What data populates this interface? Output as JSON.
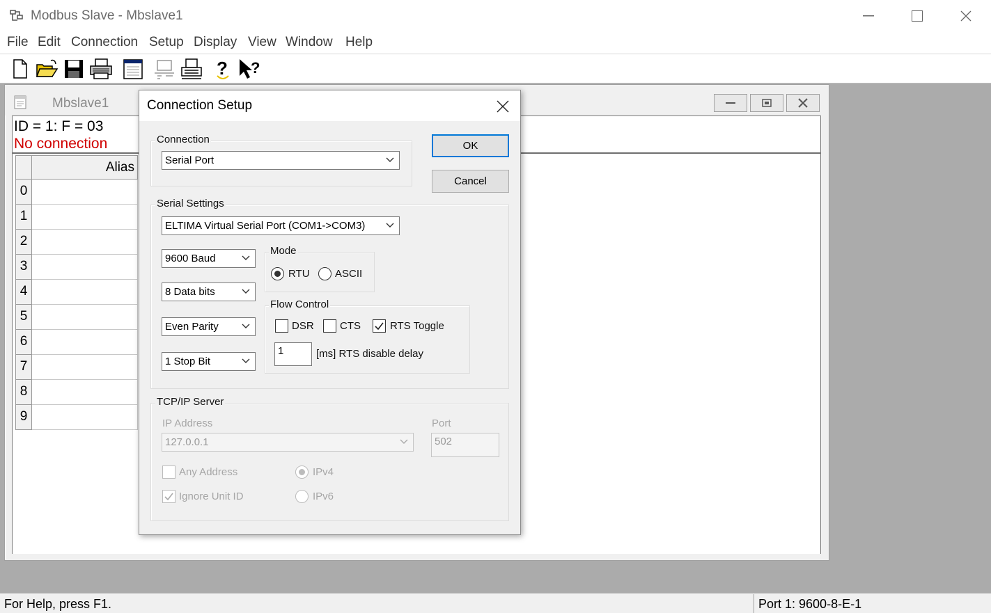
{
  "window": {
    "title": "Modbus Slave - Mbslave1",
    "minimize": "—",
    "maximize": "☐",
    "close": "✕"
  },
  "menu": [
    "File",
    "Edit",
    "Connection",
    "Setup",
    "Display",
    "View",
    "Window",
    "Help"
  ],
  "toolbar": {
    "icons": [
      "new-document-icon",
      "open-folder-icon",
      "save-icon",
      "print-icon",
      "window-icon",
      "disconnect-icon",
      "connect-printer-icon",
      "help-icon",
      "context-help-icon"
    ]
  },
  "child_window": {
    "title": "Mbslave1",
    "info_id": "ID = 1: F = 03",
    "info_status": "No connection",
    "grid_header": "Alias",
    "rows": [
      "0",
      "1",
      "2",
      "3",
      "4",
      "5",
      "6",
      "7",
      "8",
      "9"
    ]
  },
  "dialog": {
    "title": "Connection Setup",
    "close": "✕",
    "connection_label": "Connection",
    "connection_value": "Serial Port",
    "ok": "OK",
    "cancel": "Cancel",
    "serial_label": "Serial Settings",
    "port_value": "ELTIMA Virtual Serial Port (COM1->COM3)",
    "baud_value": "9600 Baud",
    "databits_value": "8 Data bits",
    "parity_value": "Even Parity",
    "stopbits_value": "1 Stop Bit",
    "mode_label": "Mode",
    "mode_rtu": "RTU",
    "mode_ascii": "ASCII",
    "mode_selected": "RTU",
    "flow_label": "Flow Control",
    "flow_dsr": "DSR",
    "flow_cts": "CTS",
    "flow_rts": "RTS Toggle",
    "flow_rts_checked": true,
    "rts_delay_value": "1",
    "rts_delay_label": "[ms] RTS disable delay",
    "tcp_label": "TCP/IP Server",
    "ip_label": "IP Address",
    "ip_value": "127.0.0.1",
    "port_label": "Port",
    "port_number": "502",
    "any_address": "Any Address",
    "ignore_unit_id": "Ignore Unit ID",
    "ipv4": "IPv4",
    "ipv6": "IPv6"
  },
  "status": {
    "help": "For Help, press F1.",
    "port": "Port 1: 9600-8-E-1"
  }
}
